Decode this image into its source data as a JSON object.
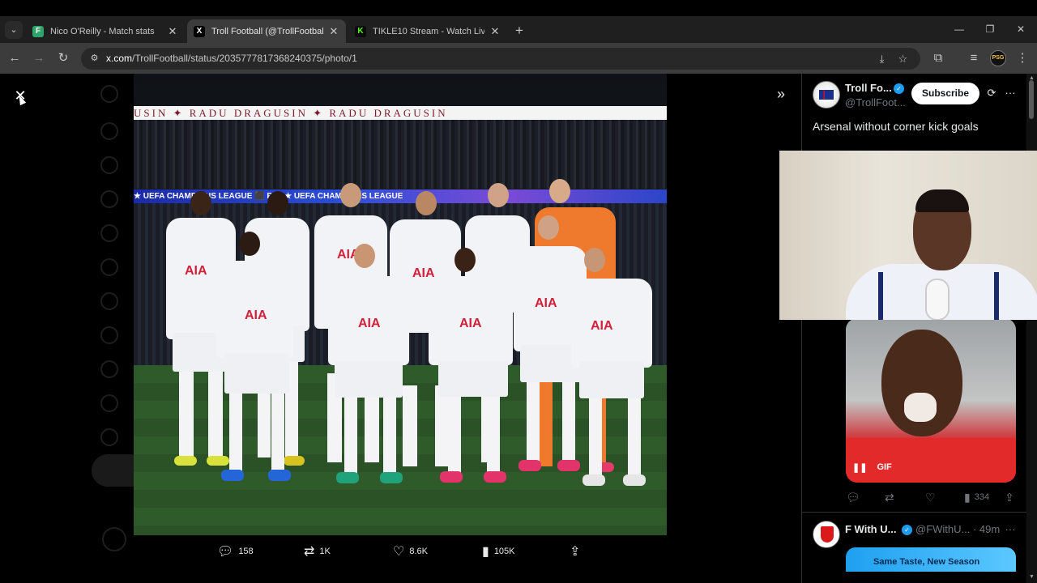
{
  "browser": {
    "tabs": [
      {
        "title": "Nico O'Reilly - Match stats",
        "favicon_letter": "F",
        "favicon_color": "#2ea36a",
        "active": false
      },
      {
        "title": "Troll Football (@TrollFootball) /",
        "favicon_letter": "X",
        "favicon_color": "#000000",
        "active": true
      },
      {
        "title": "TIKLE10 Stream - Watch Live on",
        "favicon_letter": "K",
        "favicon_color": "#53fc18",
        "active": false
      }
    ],
    "new_tab_glyph": "+",
    "url_host": "x.com",
    "url_path": "/TrollFootball/status/2035777817368240375/photo/1",
    "profile_initials": "PSG"
  },
  "photo": {
    "banner_text": "USIN ✦ RADU DRAGUSIN ✦ RADU DRAGUSIN",
    "board_text": "★ UEFA CHAMPIONS LEAGUE  ⬛ PS5  ★ UEFA CHAMPIONS LEAGUE",
    "sponsor": "AIA"
  },
  "photo_actions": {
    "replies": "158",
    "reposts": "1K",
    "likes": "8.6K",
    "views": "105K"
  },
  "post": {
    "display_name": "Troll Fo...",
    "handle": "@TrollFoot...",
    "subscribe_label": "Subscribe",
    "text": "Arsenal without corner kick goals"
  },
  "gif": {
    "badge_label": "GIF"
  },
  "reply_actions": {
    "views": "334"
  },
  "next_post": {
    "display_name": "F With U...",
    "handle": "@FWithU... · 49m",
    "preview_caption": "Same Taste, New Season"
  },
  "colors": {
    "accent": "#1d9bf0",
    "club_red": "#d3203a",
    "background": "#000000"
  }
}
